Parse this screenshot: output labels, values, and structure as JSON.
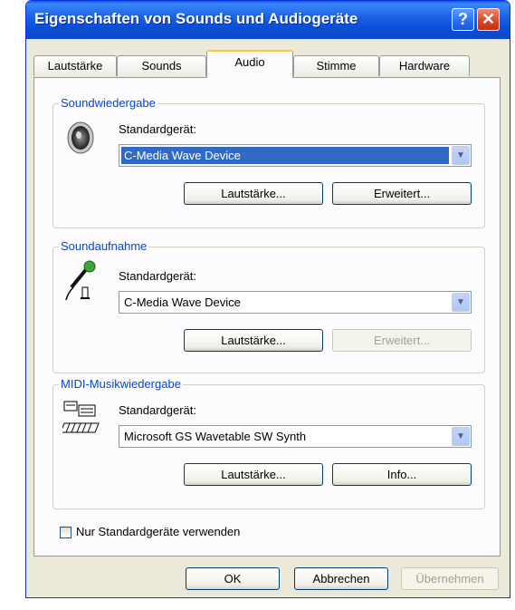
{
  "window": {
    "title": "Eigenschaften von Sounds und Audiogeräte",
    "help_glyph": "?",
    "close_glyph": "✕"
  },
  "tabs": [
    {
      "label": "Lautstärke"
    },
    {
      "label": "Sounds"
    },
    {
      "label": "Audio",
      "active": true
    },
    {
      "label": "Stimme"
    },
    {
      "label": "Hardware"
    }
  ],
  "playback": {
    "legend": "Soundwiedergabe",
    "device_label": "Standardgerät:",
    "device_value": "C-Media Wave Device",
    "volume_button": "Lautstärke...",
    "advanced_button": "Erweitert..."
  },
  "recording": {
    "legend": "Soundaufnahme",
    "device_label": "Standardgerät:",
    "device_value": "C-Media Wave Device",
    "volume_button": "Lautstärke...",
    "advanced_button": "Erweitert..."
  },
  "midi": {
    "legend": "MIDI-Musikwiedergabe",
    "device_label": "Standardgerät:",
    "device_value": "Microsoft GS Wavetable SW Synth",
    "volume_button": "Lautstärke...",
    "info_button": "Info..."
  },
  "only_default": {
    "label": "Nur Standardgeräte verwenden",
    "checked": false
  },
  "footer": {
    "ok": "OK",
    "cancel": "Abbrechen",
    "apply": "Übernehmen"
  },
  "icons": {
    "playback": "speaker-icon",
    "recording": "microphone-icon",
    "midi": "midi-keyboard-icon",
    "dropdown": "chevron-down-icon"
  },
  "colors": {
    "titlebar": "#0a4fd8",
    "selection": "#316ac5",
    "legend_text": "#0046d5",
    "tab_highlight": "#ffc83c"
  }
}
